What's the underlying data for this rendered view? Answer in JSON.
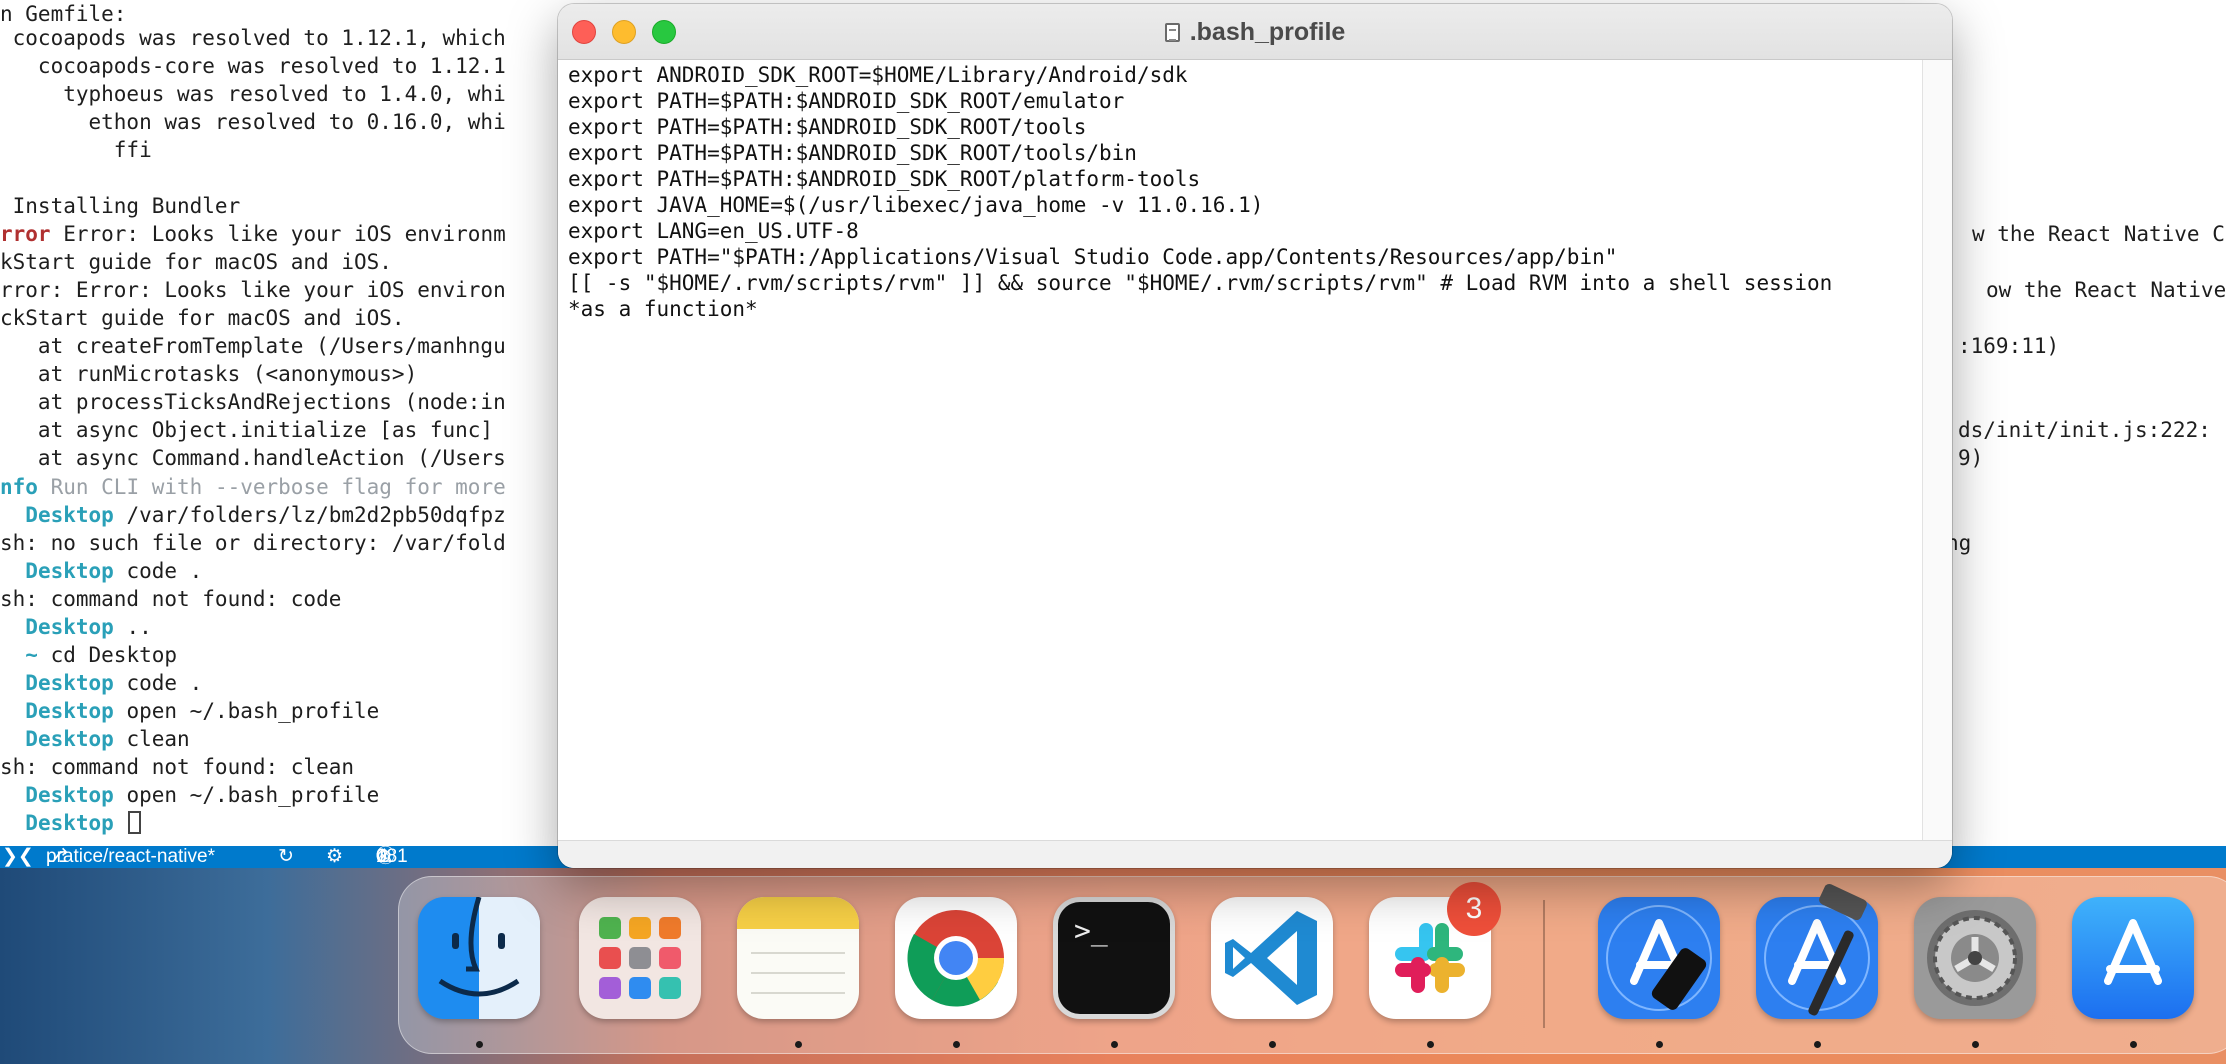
{
  "terminal": {
    "lines_left": [
      "n Gemfile:",
      " cocoapods was resolved to 1.12.1, which",
      "   cocoapods-core was resolved to 1.12.1",
      "     typhoeus was resolved to 1.4.0, whi",
      "       ethon was resolved to 0.16.0, whi",
      "         ffi",
      "",
      " Installing Bundler"
    ],
    "error_line1_tag": "rror",
    "error_line1_text": " Error: Looks like your iOS environm",
    "line_quickstart1": "kStart guide for macOS and iOS.",
    "line_error2": "rror: Error: Looks like your iOS environ",
    "line_quickstart2": "ckStart guide for macOS and iOS.",
    "stack_lines": [
      "   at createFromTemplate (/Users/manhngu",
      "   at runMicrotasks (<anonymous>)",
      "   at processTicksAndRejections (node:in",
      "   at async Object.initialize [as func]",
      "   at async Command.handleAction (/Users"
    ],
    "info_tag": "nfo",
    "info_text": " Run CLI with --verbose flag for more",
    "prompt_dir": "Desktop",
    "home_dir": "~",
    "cmd_var_folders": " /var/folders/lz/bm2d2pb50dqfpz",
    "line_no_such": "sh: no such file or directory: /var/fold",
    "cmd_code": " code .",
    "line_cmd_not_found_code": "sh: command not found: code",
    "cmd_dotdot": " ..",
    "cmd_cd_desktop": " cd Desktop",
    "cmd_open_profile": " open ~/.bash_profile",
    "cmd_clean": " clean",
    "line_cmd_not_found_clean": "sh: command not found: clean",
    "right_line1": "w the React Native C",
    "right_line2": "ow the React Native",
    "right_line3": ":169:11)",
    "right_line4": "ds/init/init.js:222:",
    "right_line5": "9)",
    "right_line6": "ng"
  },
  "status_bar": {
    "branch": "pratice/react-native*",
    "errors": "0",
    "warnings": "0",
    "info": "181"
  },
  "editor_window": {
    "title": ".bash_profile",
    "lines": [
      "export ANDROID_SDK_ROOT=$HOME/Library/Android/sdk",
      "export PATH=$PATH:$ANDROID_SDK_ROOT/emulator",
      "export PATH=$PATH:$ANDROID_SDK_ROOT/tools",
      "export PATH=$PATH:$ANDROID_SDK_ROOT/tools/bin",
      "export PATH=$PATH:$ANDROID_SDK_ROOT/platform-tools",
      "export JAVA_HOME=$(/usr/libexec/java_home -v 11.0.16.1)",
      "export LANG=en_US.UTF-8",
      "export PATH=\"$PATH:/Applications/Visual Studio Code.app/Contents/Resources/app/bin\"",
      "[[ -s \"$HOME/.rvm/scripts/rvm\" ]] && source \"$HOME/.rvm/scripts/rvm\" # Load RVM into a shell session",
      "*as a function*"
    ]
  },
  "dock": {
    "apps": [
      "Finder",
      "Launchpad",
      "Notes",
      "Google Chrome",
      "Terminal",
      "Visual Studio Code",
      "Slack",
      "Simulator",
      "Xcode",
      "System Preferences",
      "App Store"
    ],
    "slack_badge": "3"
  },
  "colors": {
    "status_bar": "#007acc",
    "error_red": "#b03030",
    "prompt_cyan": "#2aa0b8"
  }
}
